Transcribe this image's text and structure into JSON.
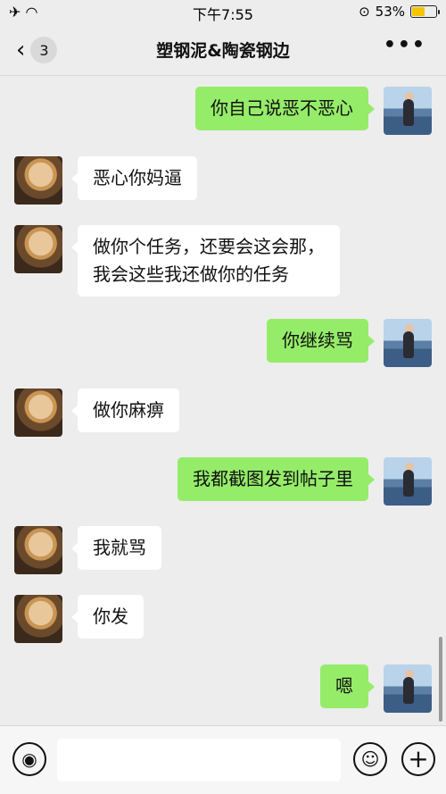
{
  "status_bar": {
    "left_icons": "✈ ︎⌔",
    "time": "下午7:55",
    "battery": "53%",
    "battery_level": 0.53
  },
  "nav": {
    "back_count": "3",
    "title": "塑钢泥&陶瓷钢边",
    "more": "•••"
  },
  "messages": [
    {
      "side": "right",
      "text": "你自己说恶不恶心"
    },
    {
      "side": "left",
      "text": "恶心你妈逼"
    },
    {
      "side": "left",
      "text": "做你个任务，还要会这会那，\n我会这些我还做你的任务"
    },
    {
      "side": "right",
      "text": "你继续骂"
    },
    {
      "side": "left",
      "text": "做你麻痹"
    },
    {
      "side": "right",
      "text": "我都截图发到帖子里"
    },
    {
      "side": "left",
      "text": "我就骂"
    },
    {
      "side": "left",
      "text": "你发"
    },
    {
      "side": "right",
      "text": "嗯"
    }
  ],
  "input": {
    "value": ""
  },
  "colors": {
    "green_bubble": "#95ec69",
    "background": "#ededed"
  }
}
